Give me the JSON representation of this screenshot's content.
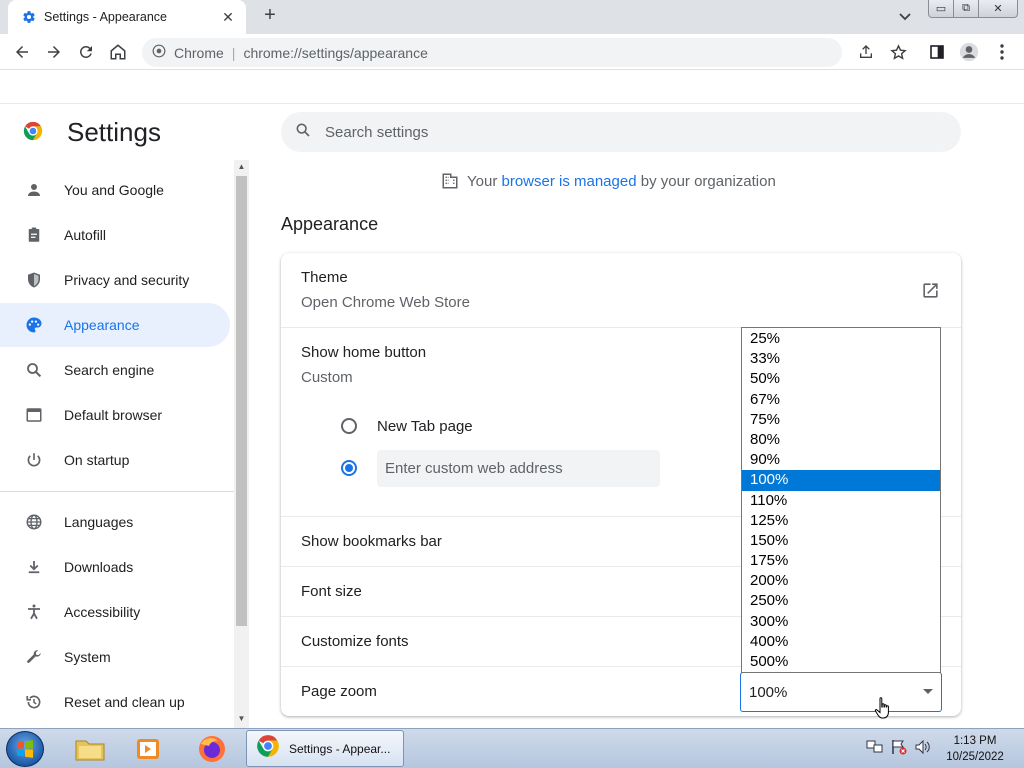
{
  "window": {
    "tab_title": "Settings - Appearance",
    "new_tab_symbol": "+",
    "close_symbol": "✕",
    "controls": {
      "minimize": "▭",
      "maximize": "⧉",
      "close": "✕"
    }
  },
  "toolbar": {
    "site_name": "Chrome",
    "url": "chrome://settings/appearance"
  },
  "header": {
    "title": "Settings",
    "search_placeholder": "Search settings"
  },
  "sidebar": {
    "items": [
      {
        "label": "You and Google",
        "icon": "person-icon"
      },
      {
        "label": "Autofill",
        "icon": "clipboard-icon"
      },
      {
        "label": "Privacy and security",
        "icon": "shield-icon"
      },
      {
        "label": "Appearance",
        "icon": "palette-icon",
        "active": true
      },
      {
        "label": "Search engine",
        "icon": "search-icon"
      },
      {
        "label": "Default browser",
        "icon": "browser-icon"
      },
      {
        "label": "On startup",
        "icon": "power-icon"
      },
      {
        "label": "Languages",
        "icon": "globe-icon"
      },
      {
        "label": "Downloads",
        "icon": "download-icon"
      },
      {
        "label": "Accessibility",
        "icon": "accessibility-icon"
      },
      {
        "label": "System",
        "icon": "wrench-icon"
      },
      {
        "label": "Reset and clean up",
        "icon": "history-icon"
      }
    ]
  },
  "managed": {
    "prefix": "Your",
    "link": "browser is managed",
    "suffix": "by your organization"
  },
  "appearance": {
    "section_title": "Appearance",
    "theme_label": "Theme",
    "theme_sub": "Open Chrome Web Store",
    "home_button_label": "Show home button",
    "home_button_sub": "Custom",
    "radio_new_tab": "New Tab page",
    "custom_address_placeholder": "Enter custom web address",
    "bookmarks_bar_label": "Show bookmarks bar",
    "font_size_label": "Font size",
    "customize_fonts_label": "Customize fonts",
    "page_zoom_label": "Page zoom",
    "page_zoom_value": "100%"
  },
  "zoom_options": [
    "25%",
    "33%",
    "50%",
    "67%",
    "75%",
    "80%",
    "90%",
    "100%",
    "110%",
    "125%",
    "150%",
    "175%",
    "200%",
    "250%",
    "300%",
    "400%",
    "500%"
  ],
  "zoom_selected": "100%",
  "taskbar": {
    "chrome_label": "Settings - Appear...",
    "time": "1:13 PM",
    "date": "10/25/2022"
  },
  "colors": {
    "accent": "#1a73e8",
    "active_nav_bg": "#e8f0fe",
    "selected_option": "#0078d7"
  }
}
